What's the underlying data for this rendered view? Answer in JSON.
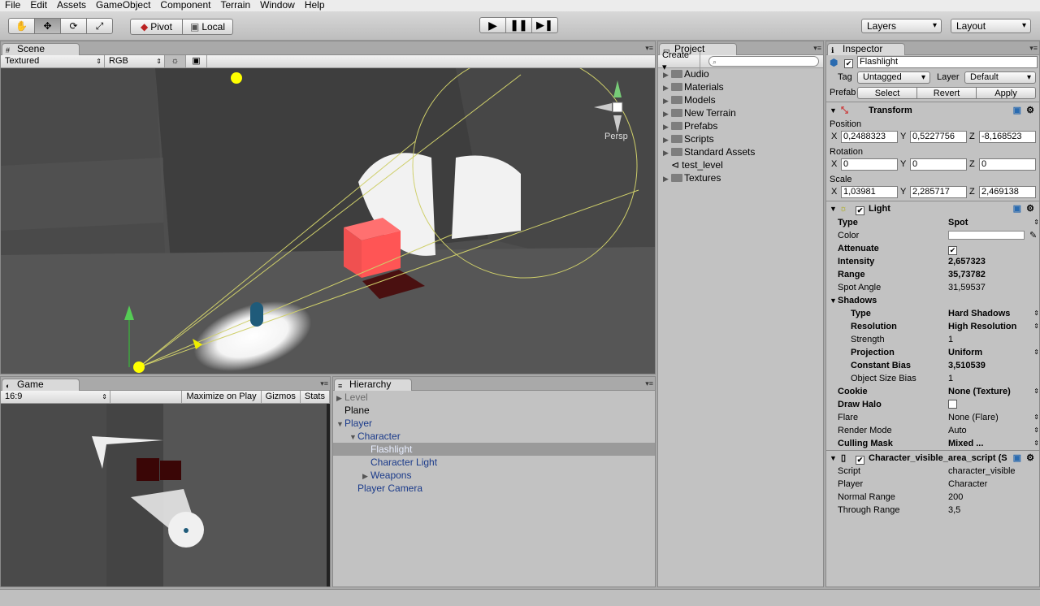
{
  "menu": [
    "File",
    "Edit",
    "Assets",
    "GameObject",
    "Component",
    "Terrain",
    "Window",
    "Help"
  ],
  "toolbar": {
    "pivot": "Pivot",
    "local": "Local",
    "layers": "Layers",
    "layout": "Layout"
  },
  "scene": {
    "tab": "Scene",
    "render_mode": "Textured",
    "color_mode": "RGB",
    "persp_label": "Persp"
  },
  "game": {
    "tab": "Game",
    "aspect": "16:9",
    "maximize": "Maximize on Play",
    "gizmos": "Gizmos",
    "stats": "Stats"
  },
  "project": {
    "tab": "Project",
    "create": "Create",
    "items": [
      "Audio",
      "Materials",
      "Models",
      "New Terrain",
      "Prefabs",
      "Scripts",
      "Standard Assets",
      "test_level",
      "Textures"
    ]
  },
  "hierarchy": {
    "tab": "Hierarchy",
    "items": [
      {
        "label": "Level",
        "indent": 0,
        "tri": "▶",
        "color": "#6b6b6b"
      },
      {
        "label": "Plane",
        "indent": 0,
        "tri": "",
        "color": "#000"
      },
      {
        "label": "Player",
        "indent": 0,
        "tri": "▼",
        "color": "#1a3a8a"
      },
      {
        "label": "Character",
        "indent": 1,
        "tri": "▼",
        "color": "#1a3a8a"
      },
      {
        "label": "Flashlight",
        "indent": 2,
        "tri": "",
        "color": "#e8eeff",
        "selected": true
      },
      {
        "label": "Character Light",
        "indent": 2,
        "tri": "",
        "color": "#1a3a8a"
      },
      {
        "label": "Weapons",
        "indent": 2,
        "tri": "▶",
        "color": "#1a3a8a"
      },
      {
        "label": "Player Camera",
        "indent": 1,
        "tri": "",
        "color": "#1a3a8a"
      }
    ]
  },
  "inspector": {
    "tab": "Inspector",
    "object_name": "Flashlight",
    "tag_label": "Tag",
    "tag": "Untagged",
    "layer_label": "Layer",
    "layer": "Default",
    "prefab_label": "Prefab",
    "select": "Select",
    "revert": "Revert",
    "apply": "Apply",
    "transform": {
      "title": "Transform",
      "position_label": "Position",
      "position": [
        "0,2488323",
        "0,5227756",
        "-8,168523"
      ],
      "rotation_label": "Rotation",
      "rotation": [
        "0",
        "0",
        "0"
      ],
      "scale_label": "Scale",
      "scale": [
        "1,03981",
        "2,285717",
        "2,469138"
      ]
    },
    "light": {
      "title": "Light",
      "rows": [
        {
          "label": "Type",
          "value": "Spot",
          "bold": true,
          "arrow": true
        },
        {
          "label": "Color",
          "value": "",
          "bold": false,
          "swatch": true
        },
        {
          "label": "Attenuate",
          "value": "",
          "bold": true,
          "check": true,
          "checked": true
        },
        {
          "label": "Intensity",
          "value": "2,657323",
          "bold": true
        },
        {
          "label": "Range",
          "value": "35,73782",
          "bold": true
        },
        {
          "label": "Spot Angle",
          "value": "31,59537",
          "bold": false
        },
        {
          "label": "Shadows",
          "value": "",
          "bold": true,
          "section": true
        },
        {
          "label": "Type",
          "value": "Hard Shadows",
          "bold": true,
          "sub": true,
          "arrow": true
        },
        {
          "label": "Resolution",
          "value": "High Resolution",
          "bold": true,
          "sub": true,
          "arrow": true
        },
        {
          "label": "Strength",
          "value": "1",
          "bold": false,
          "sub": true
        },
        {
          "label": "Projection",
          "value": "Uniform",
          "bold": true,
          "sub": true,
          "arrow": true
        },
        {
          "label": "Constant Bias",
          "value": "3,510539",
          "bold": true,
          "sub": true
        },
        {
          "label": "Object Size Bias",
          "value": "1",
          "bold": false,
          "sub": true
        },
        {
          "label": "Cookie",
          "value": "None (Texture)",
          "bold": true,
          "arrow": true
        },
        {
          "label": "Draw Halo",
          "value": "",
          "bold": true,
          "check": true,
          "checked": false
        },
        {
          "label": "Flare",
          "value": "None (Flare)",
          "bold": false,
          "arrow": true
        },
        {
          "label": "Render Mode",
          "value": "Auto",
          "bold": false,
          "arrow": true
        },
        {
          "label": "Culling Mask",
          "value": "Mixed ...",
          "bold": true,
          "arrow": true
        }
      ]
    },
    "script": {
      "title": "Character_visible_area_script (S",
      "rows": [
        {
          "label": "Script",
          "value": "character_visible"
        },
        {
          "label": "Player",
          "value": "Character"
        },
        {
          "label": "Normal Range",
          "value": "200"
        },
        {
          "label": "Through Range",
          "value": "3,5"
        }
      ]
    }
  }
}
